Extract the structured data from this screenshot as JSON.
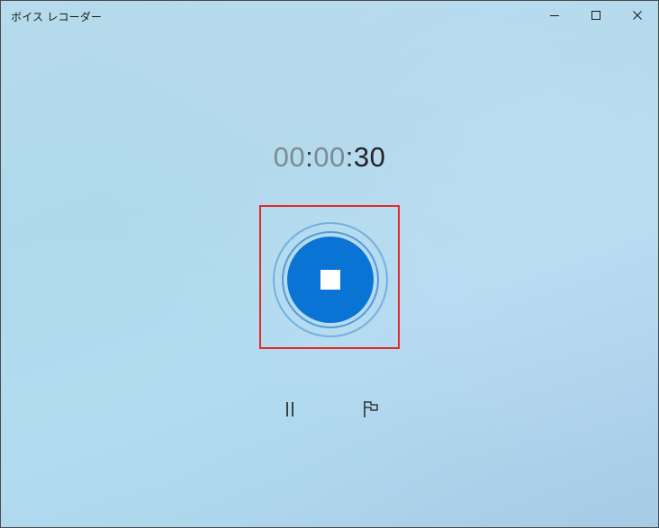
{
  "window": {
    "title": "ボイス レコーダー",
    "controls": [
      "minimize-icon",
      "maximize-icon",
      "close-icon"
    ]
  },
  "recorder": {
    "timer": {
      "hours": "00",
      "minutes": "00",
      "seconds": "30",
      "separator": ":"
    },
    "stop_icon": "stop-icon",
    "pause_icon": "pause-icon",
    "marker_icon": "flag-icon"
  },
  "colors": {
    "accent": "#0a74d4",
    "highlight_box": "#e4262b"
  }
}
